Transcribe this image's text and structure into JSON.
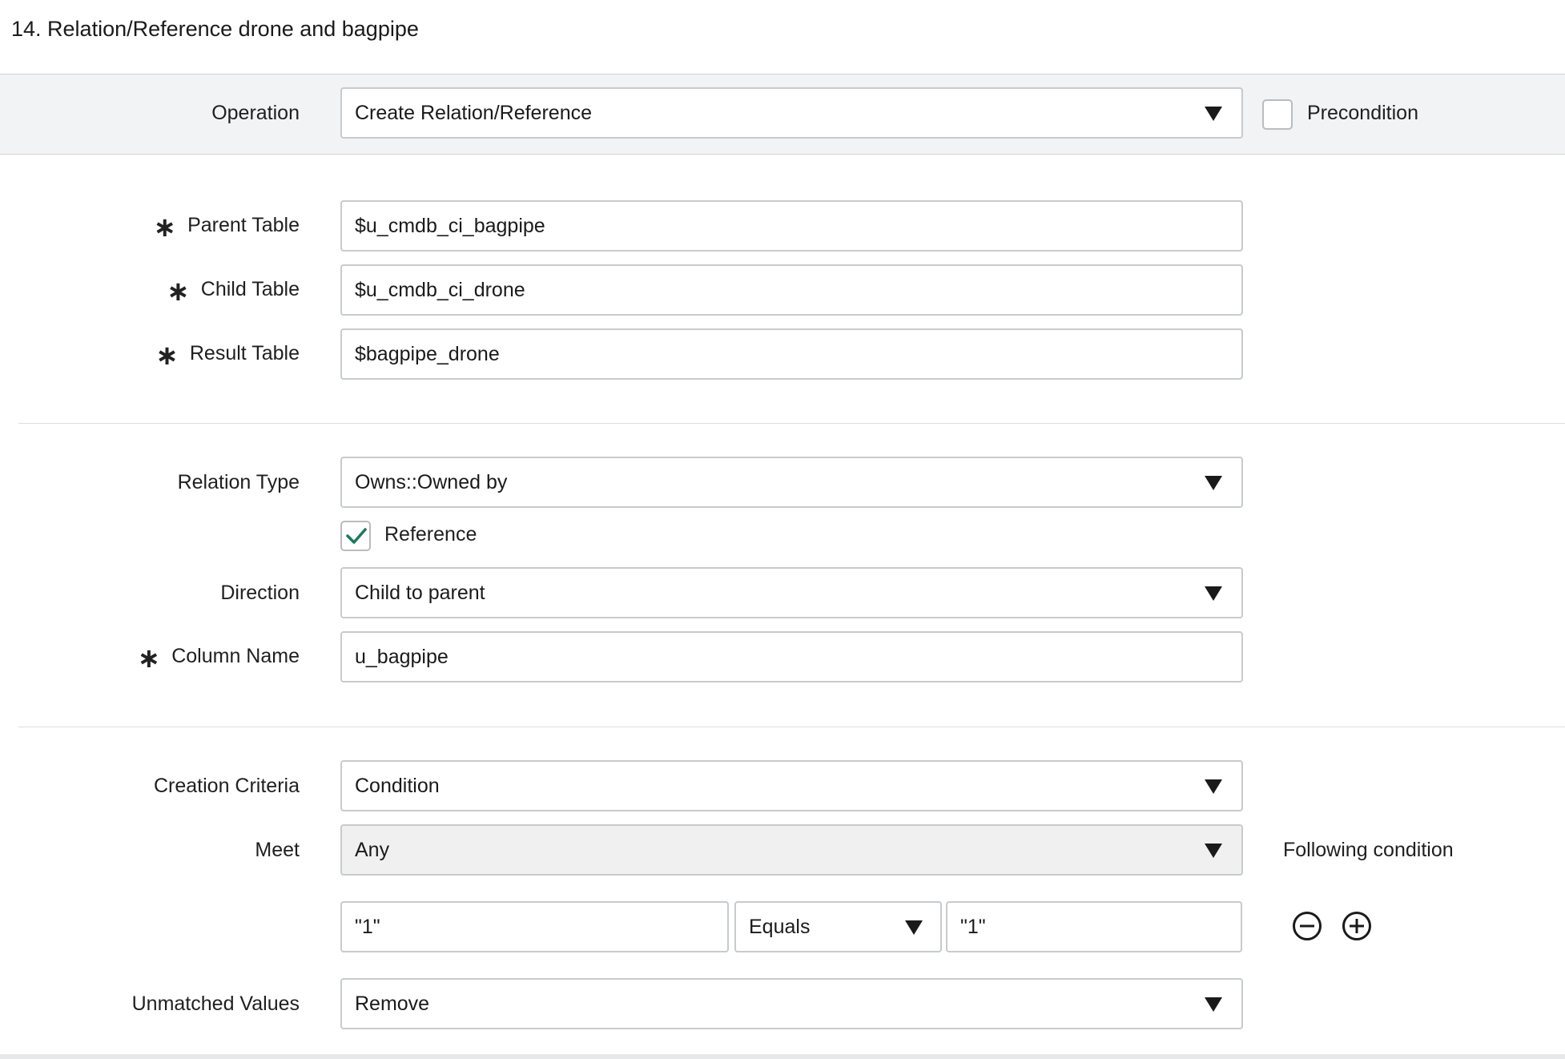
{
  "step": {
    "title": "14. Relation/Reference drone and bagpipe"
  },
  "operation": {
    "label": "Operation",
    "value": "Create Relation/Reference",
    "precondition_label": "Precondition",
    "precondition_checked": false
  },
  "tables": {
    "parent": {
      "label": "Parent Table",
      "value": "$u_cmdb_ci_bagpipe"
    },
    "child": {
      "label": "Child Table",
      "value": "$u_cmdb_ci_drone"
    },
    "result": {
      "label": "Result Table",
      "value": "$bagpipe_drone"
    },
    "required_marker": "∗"
  },
  "relation": {
    "type_label": "Relation Type",
    "type_value": "Owns::Owned by",
    "reference_label": "Reference",
    "reference_checked": true,
    "direction_label": "Direction",
    "direction_value": "Child to parent",
    "column_label": "Column Name",
    "column_value": "u_bagpipe"
  },
  "criteria": {
    "creation_label": "Creation Criteria",
    "creation_value": "Condition",
    "meet_label": "Meet",
    "meet_value": "Any",
    "following_label": "Following condition",
    "condition": {
      "left": "\"1\"",
      "operator": "Equals",
      "right": "\"1\""
    },
    "unmatched_label": "Unmatched Values",
    "unmatched_value": "Remove"
  },
  "colors": {
    "check": "#1a7a5e",
    "band": "#f2f3f4",
    "border": "#c7cbce"
  }
}
